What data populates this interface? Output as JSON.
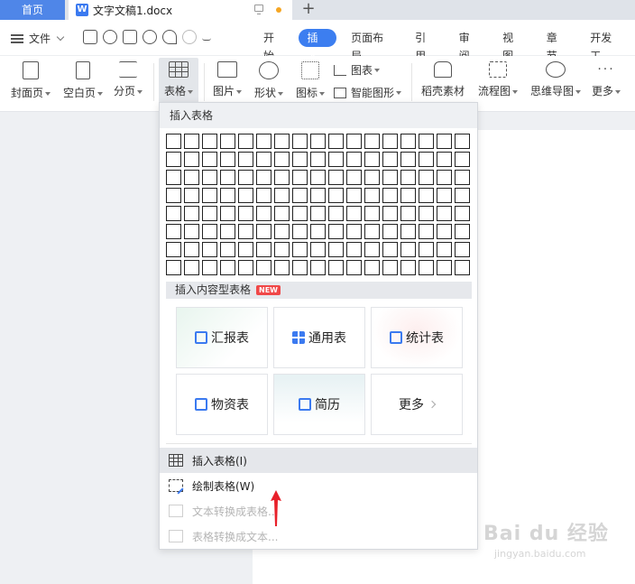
{
  "titlebar": {
    "home_tab": "首页",
    "doc_icon_letter": "W",
    "doc_title": "文字文稿1.docx"
  },
  "menubar": {
    "file_label": "文件",
    "tabs": [
      "开始",
      "插入",
      "页面布局",
      "引用",
      "审阅",
      "视图",
      "章节",
      "开发工"
    ],
    "active_tab": "插入"
  },
  "ribbon": {
    "cover_page": "封面页",
    "blank_page": "空白页",
    "page_break": "分页",
    "table": "表格",
    "picture": "图片",
    "shape": "形状",
    "icon": "图标",
    "chart": "图表",
    "smart_art": "智能图形",
    "docer_material": "稻壳素材",
    "flowchart": "流程图",
    "mindmap": "思维导图",
    "more": "更多"
  },
  "table_dropdown": {
    "header": "插入表格",
    "grid": {
      "columns": 17,
      "rows": 8
    },
    "content_section_title": "插入内容型表格",
    "new_badge": "NEW",
    "cards": {
      "report": "汇报表",
      "general": "通用表",
      "statistics": "统计表",
      "materials": "物资表",
      "resume": "简历",
      "more": "更多"
    },
    "menu": {
      "insert_table": "插入表格(I)",
      "draw_table": "绘制表格(W)",
      "text_to_table": "文本转换成表格...",
      "table_to_text": "表格转换成文本..."
    }
  },
  "watermark": {
    "main": "Bai du 经验",
    "sub": "jingyan.baidu.com"
  },
  "colors": {
    "accent": "#3c7ef0",
    "home_tab": "#4f86e8",
    "annotation_arrow": "#e8202a"
  }
}
